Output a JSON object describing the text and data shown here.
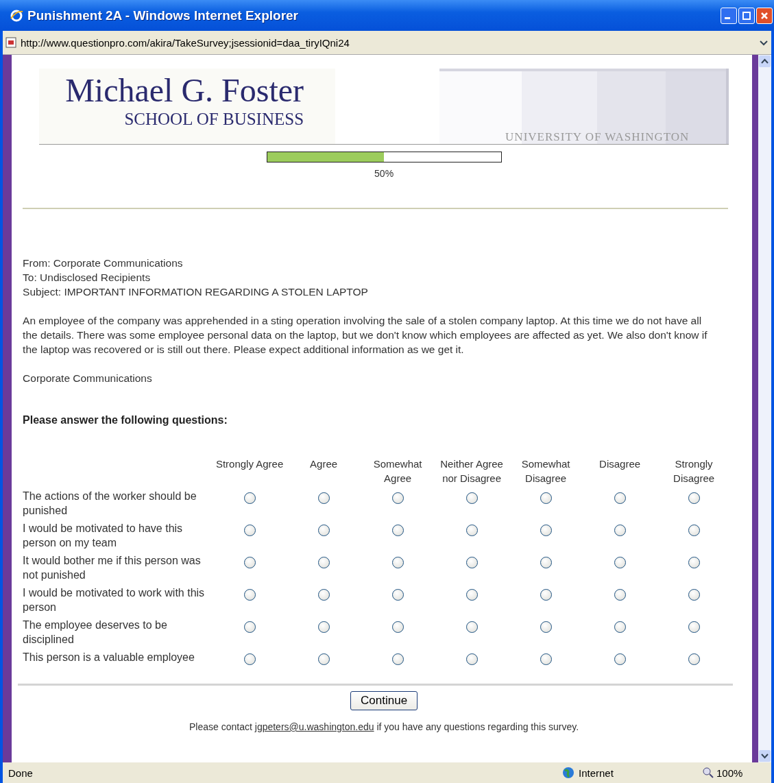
{
  "window": {
    "title": "Punishment 2A - Windows Internet Explorer",
    "address": "http://www.questionpro.com/akira/TakeSurvey;jsessionid=daa_tiryIQni24"
  },
  "header": {
    "logo_title": "Michael G. Foster",
    "logo_subtitle": "SCHOOL OF BUSINESS",
    "university": "UNIVERSITY OF WASHINGTON"
  },
  "progress": {
    "level": 0.5,
    "reading": "50%"
  },
  "message": {
    "lines": [
      "From: Corporate Communications",
      "To: Undisclosed Recipients",
      "Subject: IMPORTANT INFORMATION REGARDING A STOLEN LAPTOP"
    ],
    "body": "An employee of the company was apprehended in a sting operation involving the sale of a stolen company laptop. At this time we do not have all the details. There was some employee personal data on the laptop, but we don't know which employees are affected as yet. We also don't know if the laptop was recovered or is still out there. Please expect additional information as we get it.",
    "signature": "Corporate Communications"
  },
  "instructions": "Please answer the following questions:",
  "scale": {
    "columns": [
      "Strongly Agree",
      "Agree",
      "Somewhat Agree",
      "Neither Agree nor Disagree",
      "Somewhat Disagree",
      "Disagree",
      "Strongly Disagree"
    ],
    "rows": [
      {
        "statement": "The actions of the worker should be punished",
        "options": [
          {
            "selected": false
          },
          {
            "selected": false
          },
          {
            "selected": false
          },
          {
            "selected": false
          },
          {
            "selected": false
          },
          {
            "selected": false
          },
          {
            "selected": false
          }
        ]
      },
      {
        "statement": "I would be motivated to have this person on my team",
        "options": [
          {
            "selected": false
          },
          {
            "selected": false
          },
          {
            "selected": false
          },
          {
            "selected": false
          },
          {
            "selected": false
          },
          {
            "selected": false
          },
          {
            "selected": false
          }
        ]
      },
      {
        "statement": "It would bother me if this person was not punished",
        "options": [
          {
            "selected": false
          },
          {
            "selected": false
          },
          {
            "selected": false
          },
          {
            "selected": false
          },
          {
            "selected": false
          },
          {
            "selected": false
          },
          {
            "selected": false
          }
        ]
      },
      {
        "statement": "I would be motivated to work with this person",
        "options": [
          {
            "selected": false
          },
          {
            "selected": false
          },
          {
            "selected": false
          },
          {
            "selected": false
          },
          {
            "selected": false
          },
          {
            "selected": false
          },
          {
            "selected": false
          }
        ]
      },
      {
        "statement": "The employee deserves to be disciplined",
        "options": [
          {
            "selected": false
          },
          {
            "selected": false
          },
          {
            "selected": false
          },
          {
            "selected": false
          },
          {
            "selected": false
          },
          {
            "selected": false
          },
          {
            "selected": false
          }
        ]
      },
      {
        "statement": "This person is a valuable employee",
        "options": [
          {
            "selected": false
          },
          {
            "selected": false
          },
          {
            "selected": false
          },
          {
            "selected": false
          },
          {
            "selected": false
          },
          {
            "selected": false
          },
          {
            "selected": false
          }
        ]
      }
    ]
  },
  "continue_button": "Continue",
  "contact": {
    "before": "Please contact",
    "link": "jgpeters@u.washington.edu",
    "after": "if you have any questions regarding this survey."
  },
  "status_bar": {
    "status": "Done",
    "zone": "Internet",
    "zoom": "100%"
  }
}
